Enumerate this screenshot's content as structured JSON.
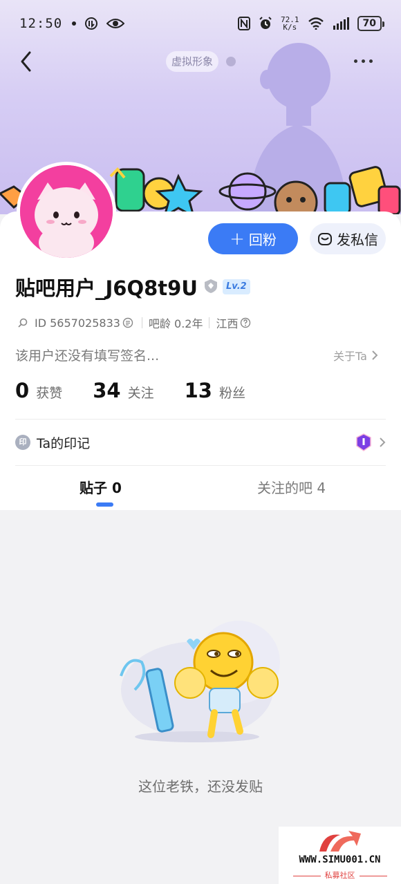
{
  "status_bar": {
    "time": "12:50",
    "net_speed_value": "72.1",
    "net_speed_unit": "K/s",
    "battery": "70"
  },
  "header": {
    "avatar_chip": "虚拟形象"
  },
  "profile": {
    "username": "贴吧用户_J6Q8t9U",
    "level": "Lv.2",
    "id_label": "ID 5657025833",
    "age": "吧龄 0.2年",
    "location": "江西",
    "bio": "该用户还没有填写签名...",
    "about": "关于Ta"
  },
  "actions": {
    "follow_back": "回粉",
    "message": "发私信"
  },
  "stats": [
    {
      "num": "0",
      "label": "获赞"
    },
    {
      "num": "34",
      "label": "关注"
    },
    {
      "num": "13",
      "label": "粉丝"
    }
  ],
  "imprint": {
    "icon_text": "印",
    "label": "Ta的印记"
  },
  "tabs": {
    "posts": "贴子 0",
    "followed_bars": "关注的吧 4"
  },
  "empty_state": {
    "text": "这位老铁，还没发贴"
  },
  "watermark": {
    "url": "WWW.SIMU001.CN",
    "sub": "私募社区"
  },
  "colors": {
    "accent": "#3b7bf5",
    "avatar_bg": "#f33f9f",
    "hero_bg": "#d6cdf4"
  }
}
